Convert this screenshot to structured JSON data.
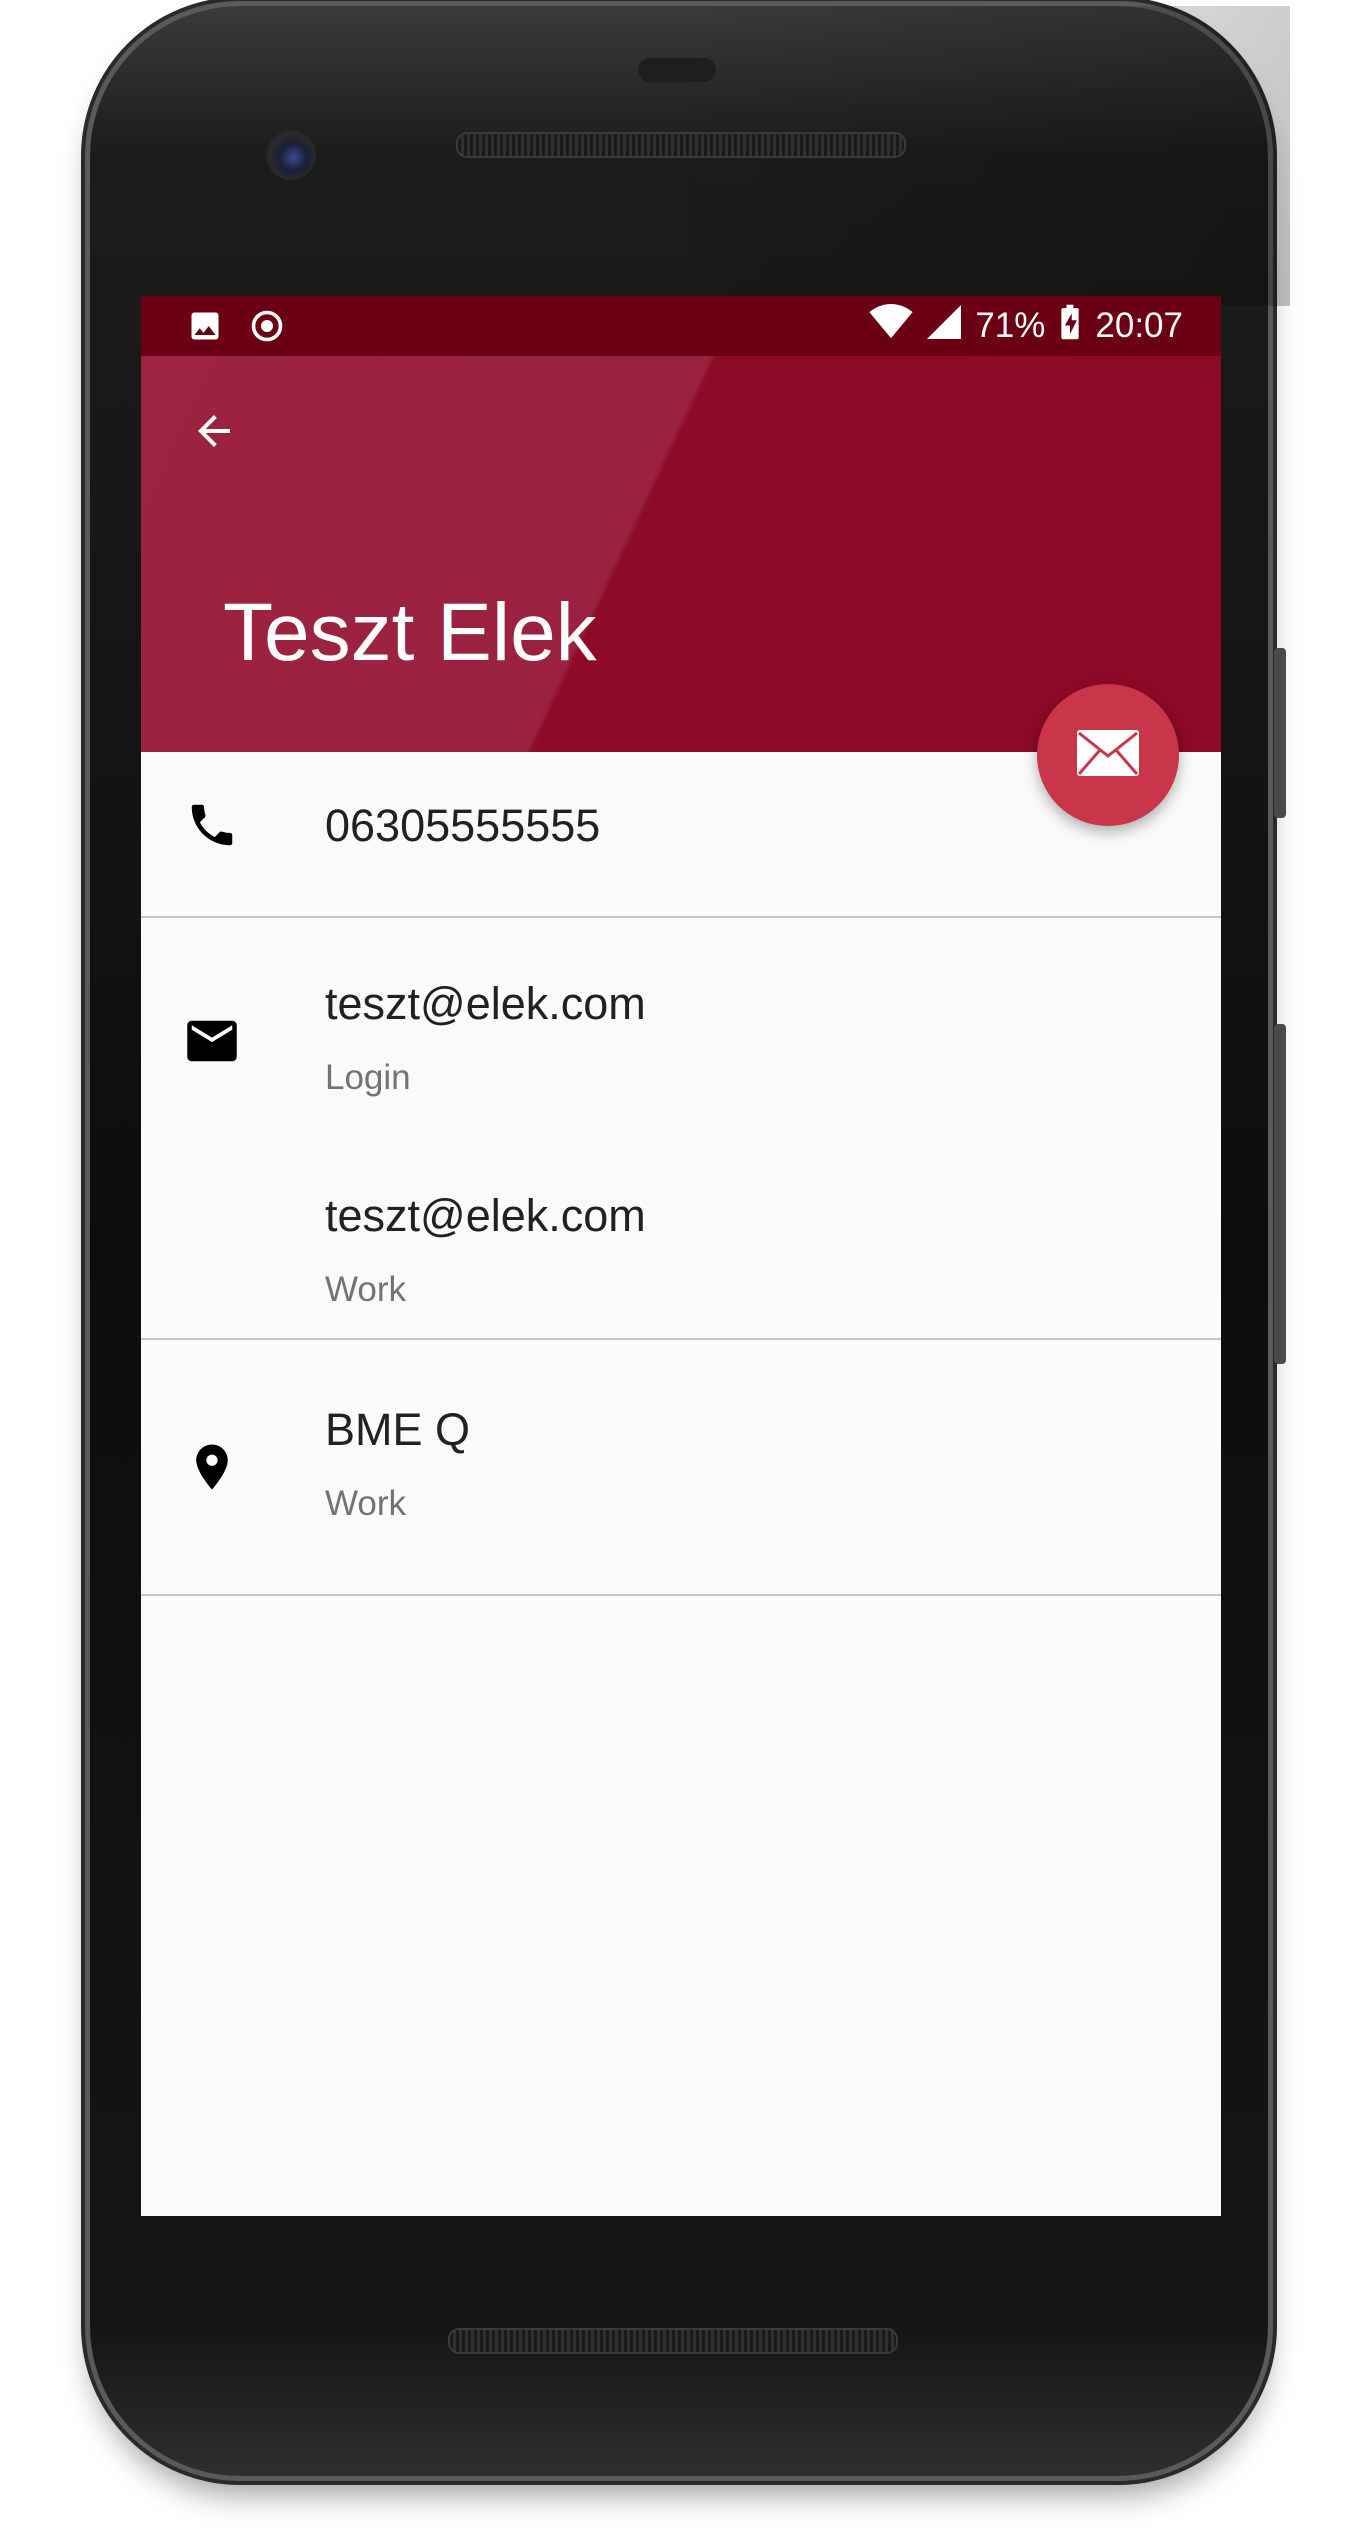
{
  "status_bar": {
    "battery": "71%",
    "time": "20:07"
  },
  "app_bar": {
    "title": "Teszt Elek"
  },
  "phone": {
    "number": "06305555555"
  },
  "emails": [
    {
      "address": "teszt@elek.com",
      "type": "Login"
    },
    {
      "address": "teszt@elek.com",
      "type": "Work"
    }
  ],
  "address": {
    "value": "BME Q",
    "type": "Work"
  },
  "icons": {
    "back": "arrow-back-icon",
    "fab": "email-icon",
    "phone": "phone-icon",
    "email": "email-icon",
    "location": "location-pin-icon"
  },
  "colors": {
    "primary": "#8c0a27",
    "primary_dark": "#6b0014",
    "accent": "#c9364a"
  }
}
